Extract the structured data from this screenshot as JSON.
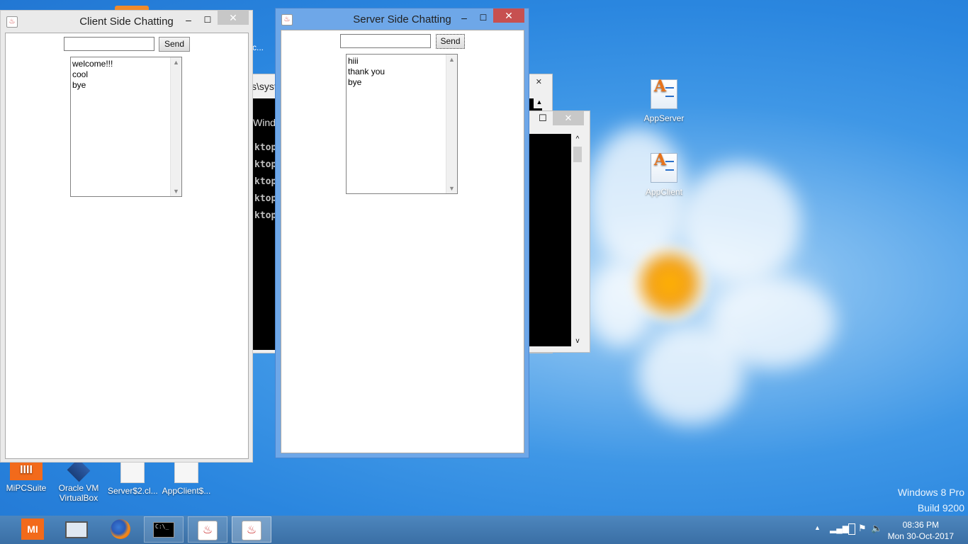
{
  "desktop": {
    "icons": [
      {
        "label": "AppServer"
      },
      {
        "label": "AppClient"
      },
      {
        "label": "MiPCSuite"
      },
      {
        "label_line1": "Oracle VM",
        "label_line2": "VirtualBox"
      },
      {
        "label": "Server$2.cl..."
      },
      {
        "label": "AppClient$..."
      }
    ],
    "partial_label": "c...",
    "watermark_line1": "Windows 8 Pro",
    "watermark_line2": "Build 9200"
  },
  "console_back": {
    "path_fragment": "s\\syst",
    "line_windows": "Wind",
    "lines": [
      "ktop",
      "ktop",
      "ktop",
      "ktop",
      "ktop"
    ]
  },
  "client_window": {
    "title": "Client Side Chatting",
    "input_value": "",
    "send_label": "Send",
    "messages": [
      "welcome!!!",
      "cool",
      "bye"
    ]
  },
  "server_window": {
    "title": "Server Side Chatting",
    "input_value": "",
    "send_label": "Send",
    "messages": [
      "hiii",
      "thank you",
      "bye"
    ]
  },
  "window_controls": {
    "minimize": "–",
    "maximize": "☐",
    "close": "✕"
  },
  "taskbar": {
    "time": "08:36 PM",
    "date": "Mon 30-Oct-2017",
    "mi_label": "MI",
    "cmd_label": "C:\\_"
  },
  "colors": {
    "accent_active_border": "#5b9be6",
    "close_button": "#c75050",
    "taskbar": "#3f76ad"
  }
}
